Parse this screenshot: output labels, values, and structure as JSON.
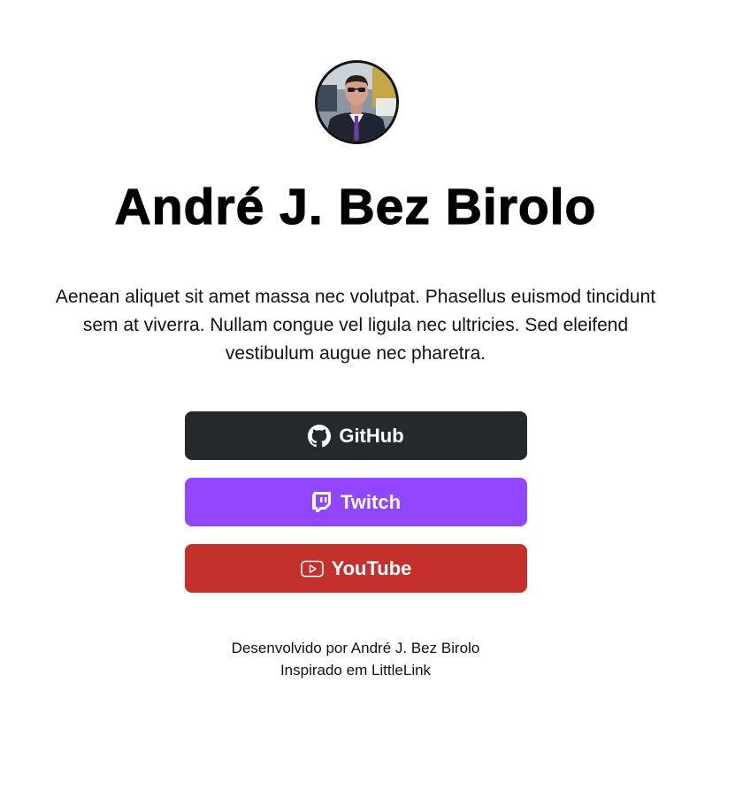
{
  "profile": {
    "name": "André J. Bez Birolo",
    "bio": "Aenean aliquet sit amet massa nec volutpat. Phasellus euismod tincidunt sem at viverra. Nullam congue vel ligula nec ultricies. Sed eleifend vestibulum augue nec pharetra."
  },
  "links": {
    "github": {
      "label": "GitHub",
      "icon": "github-icon",
      "color": "#24292e"
    },
    "twitch": {
      "label": "Twitch",
      "icon": "twitch-icon",
      "color": "#9146ff"
    },
    "youtube": {
      "label": "YouTube",
      "icon": "youtube-icon",
      "color": "#c4302b"
    }
  },
  "footer": {
    "line1": "Desenvolvido por André J. Bez Birolo",
    "line2": "Inspirado em LittleLink"
  }
}
